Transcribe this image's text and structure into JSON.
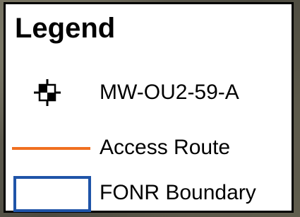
{
  "legend": {
    "title": "Legend",
    "items": [
      {
        "label": "MW-OU2-59-A",
        "symbol": "well-marker-icon",
        "color": "#000000"
      },
      {
        "label": "Access Route",
        "symbol": "line",
        "color": "#f06f20"
      },
      {
        "label": "FONR Boundary",
        "symbol": "outline-box",
        "color": "#1f54a8"
      }
    ]
  }
}
